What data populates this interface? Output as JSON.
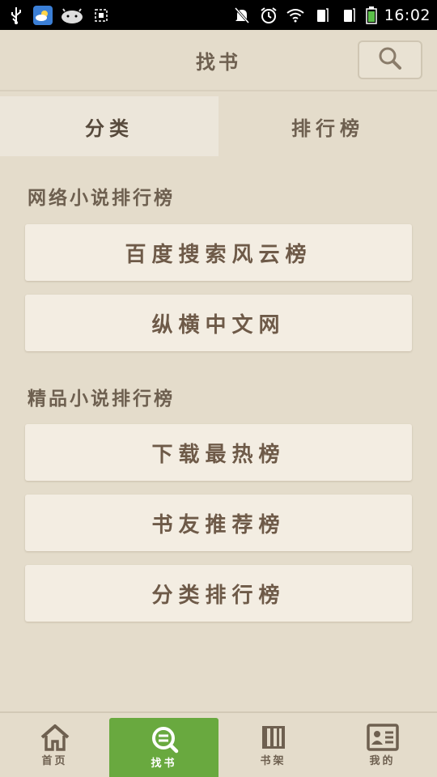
{
  "status_bar": {
    "time": "16:02",
    "left_icons": [
      "usb-icon",
      "weather-icon",
      "android-icon",
      "screenshot-icon"
    ],
    "right_icons": [
      "mute-icon",
      "alarm-icon",
      "wifi-icon",
      "sim1-icon",
      "sim2-icon",
      "battery-icon"
    ]
  },
  "header": {
    "title": "找书",
    "search_icon": "search-icon"
  },
  "tabs": [
    {
      "label": "分类",
      "active": true
    },
    {
      "label": "排行榜",
      "active": false
    }
  ],
  "sections": [
    {
      "title": "网络小说排行榜",
      "items": [
        "百度搜索风云榜",
        "纵横中文网"
      ]
    },
    {
      "title": "精品小说排行榜",
      "items": [
        "下载最热榜",
        "书友推荐榜",
        "分类排行榜"
      ]
    }
  ],
  "bottom_nav": [
    {
      "label": "首页",
      "icon": "home-icon",
      "active": false
    },
    {
      "label": "找书",
      "icon": "find-book-icon",
      "active": true
    },
    {
      "label": "书架",
      "icon": "bookshelf-icon",
      "active": false
    },
    {
      "label": "我的",
      "icon": "profile-icon",
      "active": false
    }
  ],
  "colors": {
    "background": "#e4dccb",
    "button_bg": "#f3ede2",
    "text": "#6e6050",
    "active_nav": "#69a93f"
  }
}
